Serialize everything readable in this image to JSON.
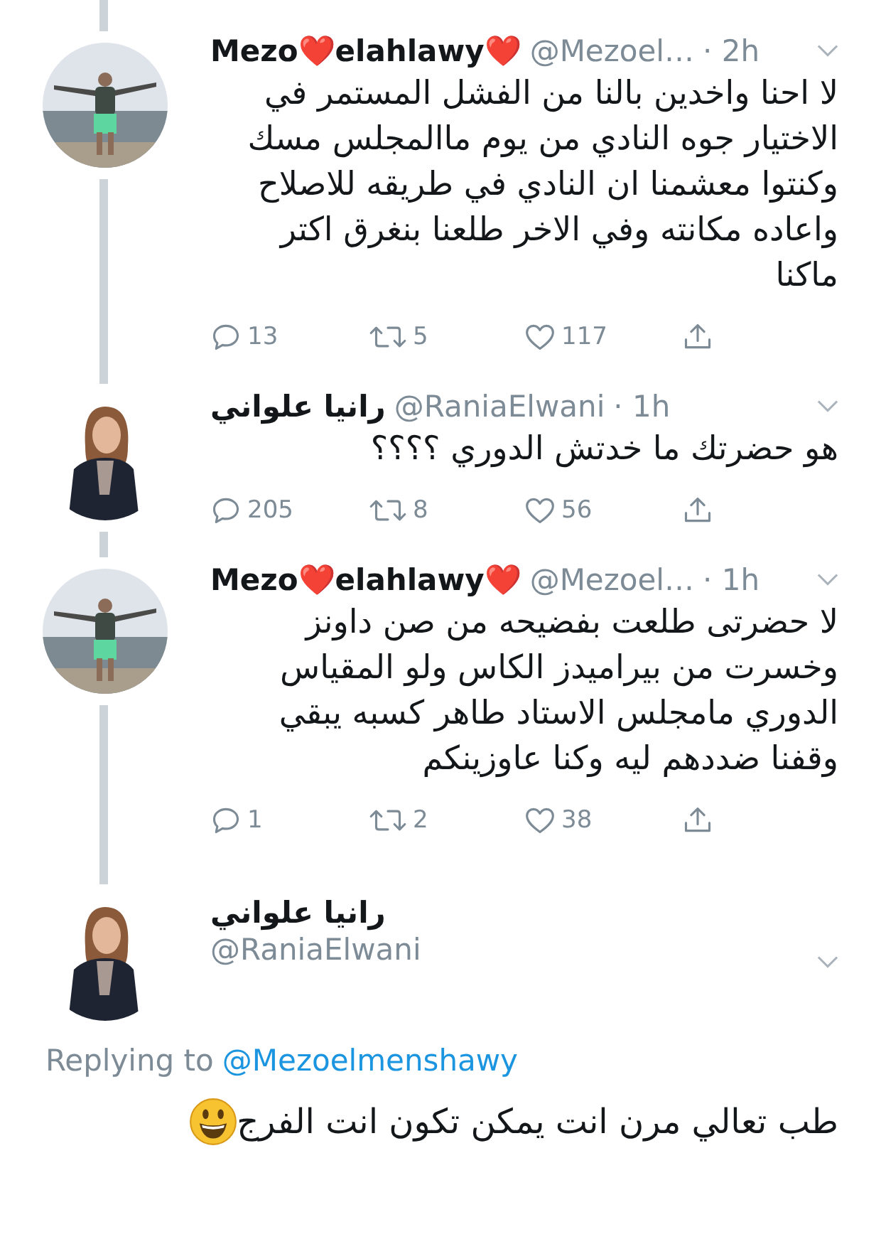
{
  "tweets": [
    {
      "kind": "reply",
      "name": "Mezo❤️elahlawy❤️",
      "handle": "@Mezoel…",
      "time": "· 2h",
      "text": "لا احنا واخدين بالنا من الفشل المستمر في الاختيار جوه النادي من يوم ماالمجلس مسك وكنتوا معشمنا ان النادي في طريقه للاصلاح واعاده مكانته وفي الاخر طلعنا بنغرق اكتر ماكنا",
      "replies": "13",
      "retweets": "5",
      "likes": "117"
    },
    {
      "kind": "reply",
      "name": "رانيا علواني",
      "handle": "@RaniaElwani",
      "time": "· 1h",
      "text": "هو حضرتك ما خدتش الدوري ؟؟؟؟",
      "replies": "205",
      "retweets": "8",
      "likes": "56"
    },
    {
      "kind": "reply",
      "name": "Mezo❤️elahlawy❤️",
      "handle": "@Mezoel…",
      "time": "· 1h",
      "text": "لا حضرتى طلعت بفضيحه من صن داونز وخسرت من بيراميدز الكاس ولو المقياس الدوري مامجلس الاستاد طاهر كسبه يبقي وقفنا ضددهم ليه وكنا عاوزينكم",
      "replies": "1",
      "retweets": "2",
      "likes": "38"
    },
    {
      "kind": "focused",
      "name": "رانيا علواني",
      "handle": "@RaniaElwani",
      "replying_label": "Replying to",
      "replying_handle": "@Mezoelmenshawy",
      "text": "طب تعالي مرن انت يمكن تكون انت الفرج"
    }
  ]
}
